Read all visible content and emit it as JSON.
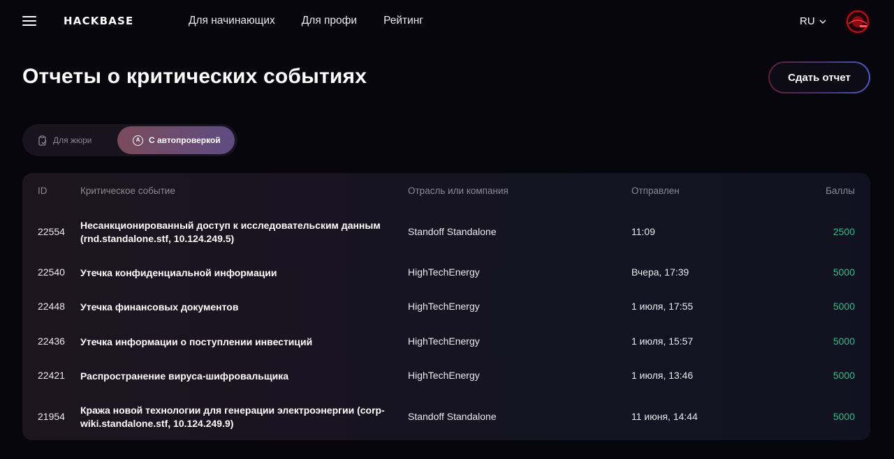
{
  "header": {
    "logo": "HACKBASE",
    "nav": [
      "Для начинающих",
      "Для профи",
      "Рейтинг"
    ],
    "lang": "RU"
  },
  "page": {
    "title": "Отчеты о критических событиях",
    "submit_label": "Сдать отчет"
  },
  "switch": {
    "jury_label": "Для жюри",
    "auto_label": "С автопроверкой",
    "auto_icon_letter": "A"
  },
  "table": {
    "headers": {
      "id": "ID",
      "event": "Критическое событие",
      "company": "Отрасль или компания",
      "sent": "Отправлен",
      "score": "Баллы"
    },
    "rows": [
      {
        "id": "22554",
        "event": "Несанкционированный доступ к исследовательским данным (rnd.standalone.stf, 10.124.249.5)",
        "company": "Standoff Standalone",
        "sent": "11:09",
        "score": "2500"
      },
      {
        "id": "22540",
        "event": "Утечка конфиденциальной информации",
        "company": "HighTechEnergy",
        "sent": "Вчера, 17:39",
        "score": "5000"
      },
      {
        "id": "22448",
        "event": "Утечка финансовых документов",
        "company": "HighTechEnergy",
        "sent": "1 июля, 17:55",
        "score": "5000"
      },
      {
        "id": "22436",
        "event": "Утечка информации о поступлении инвестиций",
        "company": "HighTechEnergy",
        "sent": "1 июля, 15:57",
        "score": "5000"
      },
      {
        "id": "22421",
        "event": "Распространение вируса-шифровальщика",
        "company": "HighTechEnergy",
        "sent": "1 июля, 13:46",
        "score": "5000"
      },
      {
        "id": "21954",
        "event": "Кража новой технологии для генерации электроэнергии (corp-wiki.standalone.stf, 10.124.249.9)",
        "company": "Standoff Standalone",
        "sent": "11 июня, 14:44",
        "score": "5000"
      }
    ]
  },
  "colors": {
    "background": "#07060c",
    "score_green": "#2fbd86",
    "accent_purple": "#5e4c83"
  }
}
